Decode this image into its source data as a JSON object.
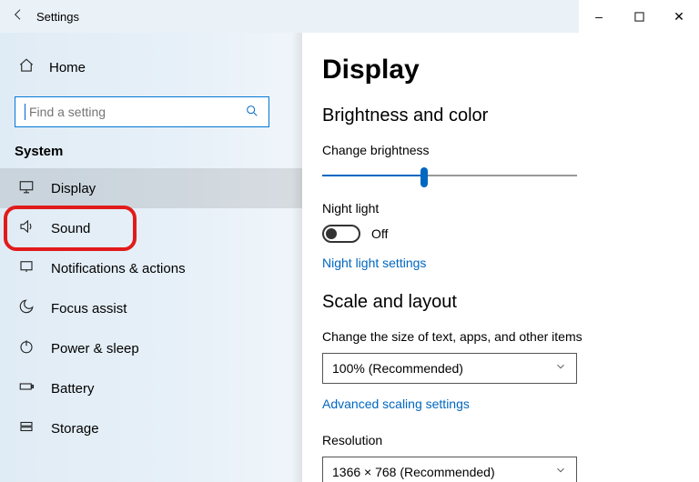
{
  "window": {
    "app_title": "Settings",
    "buttons": {
      "min": "–",
      "max": "□",
      "close": "✕"
    }
  },
  "sidebar": {
    "home": "Home",
    "search_placeholder": "Find a setting",
    "group_label": "System",
    "items": [
      {
        "label": "Display",
        "icon": "display-icon",
        "selected": true
      },
      {
        "label": "Sound",
        "icon": "sound-icon"
      },
      {
        "label": "Notifications & actions",
        "icon": "notifications-icon"
      },
      {
        "label": "Focus assist",
        "icon": "focus-icon"
      },
      {
        "label": "Power & sleep",
        "icon": "power-icon"
      },
      {
        "label": "Battery",
        "icon": "battery-icon"
      },
      {
        "label": "Storage",
        "icon": "storage-icon"
      }
    ]
  },
  "main": {
    "title": "Display",
    "section_brightness": "Brightness and color",
    "brightness_label": "Change brightness",
    "brightness_percent": 40,
    "night_light_label": "Night light",
    "night_light_state": "Off",
    "night_light_link": "Night light settings",
    "section_scale": "Scale and layout",
    "scale_label": "Change the size of text, apps, and other items",
    "scale_value": "100% (Recommended)",
    "advanced_scaling_link": "Advanced scaling settings",
    "resolution_label": "Resolution",
    "resolution_value": "1366 × 768 (Recommended)"
  }
}
